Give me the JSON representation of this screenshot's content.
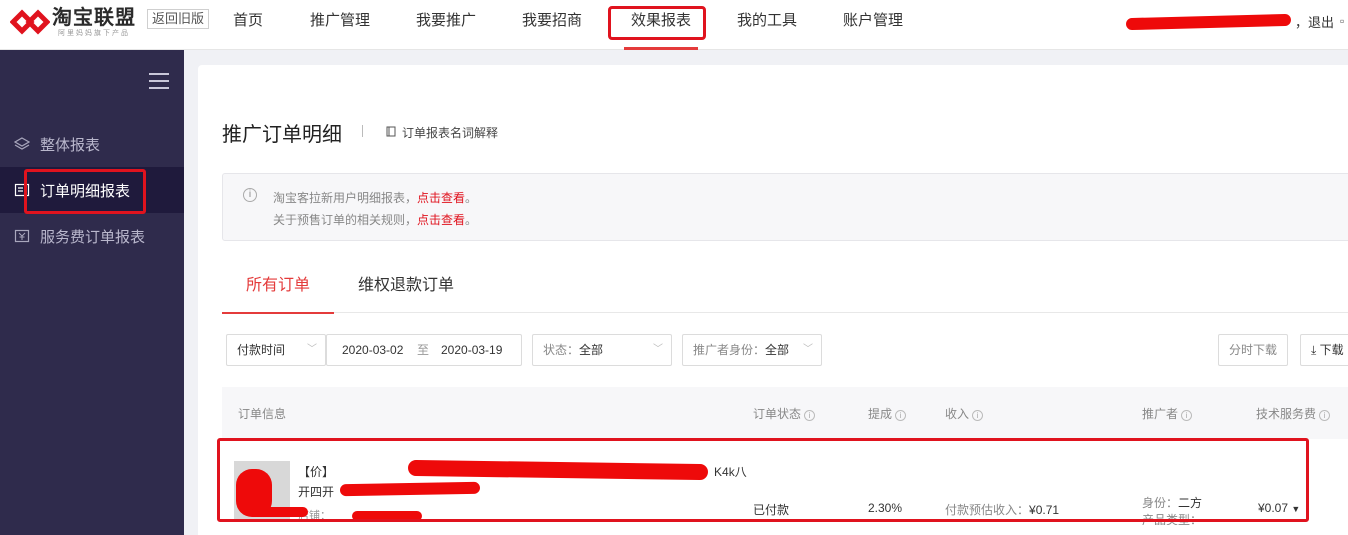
{
  "app": {
    "logo_title": "淘宝联盟",
    "logo_subtitle": "阿里妈妈旗下产品",
    "back_old_label": "返回旧版"
  },
  "nav": {
    "items": [
      {
        "label": "首页"
      },
      {
        "label": "推广管理"
      },
      {
        "label": "我要推广"
      },
      {
        "label": "我要招商"
      },
      {
        "label": "效果报表"
      },
      {
        "label": "我的工具"
      },
      {
        "label": "账户管理"
      }
    ],
    "active_index": 4,
    "logout_label": "，退出"
  },
  "sidebar": {
    "items": [
      {
        "label": "整体报表",
        "icon": "layers-icon"
      },
      {
        "label": "订单明细报表",
        "icon": "document-icon"
      },
      {
        "label": "服务费订单报表",
        "icon": "fee-icon"
      }
    ],
    "active_index": 1
  },
  "page": {
    "title": "推广订单明细",
    "glossary_label": "订单报表名词解释"
  },
  "notice": {
    "line1_text": "淘宝客拉新用户明细报表，",
    "line1_link": "点击查看",
    "line1_end": "。",
    "line2_text": "关于预售订单的相关规则，",
    "line2_link": "点击查看",
    "line2_end": "。"
  },
  "tabs": [
    {
      "label": "所有订单"
    },
    {
      "label": "维权退款订单"
    }
  ],
  "filters": {
    "time_type": "付款时间",
    "start_date": "2020-03-02",
    "range_sep": "至",
    "end_date": "2020-03-19",
    "status_label": "状态：",
    "status_value": "全部",
    "role_label": "推广者身份：",
    "role_value": "全部",
    "split_download": "分时下载",
    "download": "下载"
  },
  "table": {
    "headers": {
      "order_info": "订单信息",
      "order_status": "订单状态",
      "commission": "提成",
      "income": "收入",
      "promoter": "推广者",
      "tech_fee": "技术服务费"
    },
    "row": {
      "title_line1_prefix": "【",
      "title_line1_fragment": "价】",
      "title_line1_suffix": "K4k八",
      "title_line2_prefix": "开四开",
      "shop_prefix": "店铺：",
      "status": "已付款",
      "commission": "2.30%",
      "income_label": "付款预估收入：",
      "income_value": "¥0.71",
      "role_label": "身份：",
      "role_value": "二方",
      "category_label": "产品类型：",
      "category_value": "--",
      "tech_fee": "¥0.07"
    }
  },
  "colors": {
    "accent": "#e43b3b",
    "sidebar_bg": "#2f2b4c",
    "annotation": "#e0131e"
  }
}
